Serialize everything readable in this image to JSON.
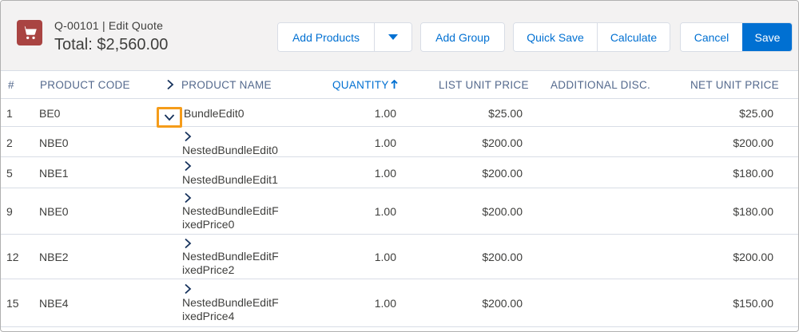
{
  "header": {
    "subtitle": "Q-00101 | Edit Quote",
    "total": "Total: $2,560.00",
    "icon": "shopping-cart-icon",
    "icon_color": "#a94442"
  },
  "toolbar": {
    "add_products": "Add Products",
    "add_group": "Add Group",
    "quick_save": "Quick Save",
    "calculate": "Calculate",
    "cancel": "Cancel",
    "save": "Save",
    "brand_color": "#0070d2"
  },
  "table": {
    "columns": {
      "num": "#",
      "product_code": "PRODUCT CODE",
      "product_name": "PRODUCT NAME",
      "quantity": "QUANTITY",
      "list_unit_price": "LIST UNIT PRICE",
      "additional_disc": "ADDITIONAL DISC.",
      "net_unit_price": "NET UNIT PRICE"
    },
    "rows": [
      {
        "num": "1",
        "code": "BE0",
        "name1": "BundleEdit0",
        "name2": "",
        "qty": "1.00",
        "list": "$25.00",
        "disc": "",
        "net": "$25.00"
      },
      {
        "num": "2",
        "code": "NBE0",
        "name1": "NestedBundleEdit0",
        "name2": "",
        "qty": "1.00",
        "list": "$200.00",
        "disc": "",
        "net": "$200.00"
      },
      {
        "num": "5",
        "code": "NBE1",
        "name1": "NestedBundleEdit1",
        "name2": "",
        "qty": "1.00",
        "list": "$200.00",
        "disc": "",
        "net": "$180.00"
      },
      {
        "num": "9",
        "code": "NBE0",
        "name1": "NestedBundleEditF",
        "name2": "ixedPrice0",
        "qty": "1.00",
        "list": "$200.00",
        "disc": "",
        "net": "$180.00"
      },
      {
        "num": "12",
        "code": "NBE2",
        "name1": "NestedBundleEditF",
        "name2": "ixedPrice2",
        "qty": "1.00",
        "list": "$200.00",
        "disc": "",
        "net": "$200.00"
      },
      {
        "num": "15",
        "code": "NBE4",
        "name1": "NestedBundleEditF",
        "name2": "ixedPrice4",
        "qty": "1.00",
        "list": "$200.00",
        "disc": "",
        "net": "$150.00"
      }
    ]
  }
}
